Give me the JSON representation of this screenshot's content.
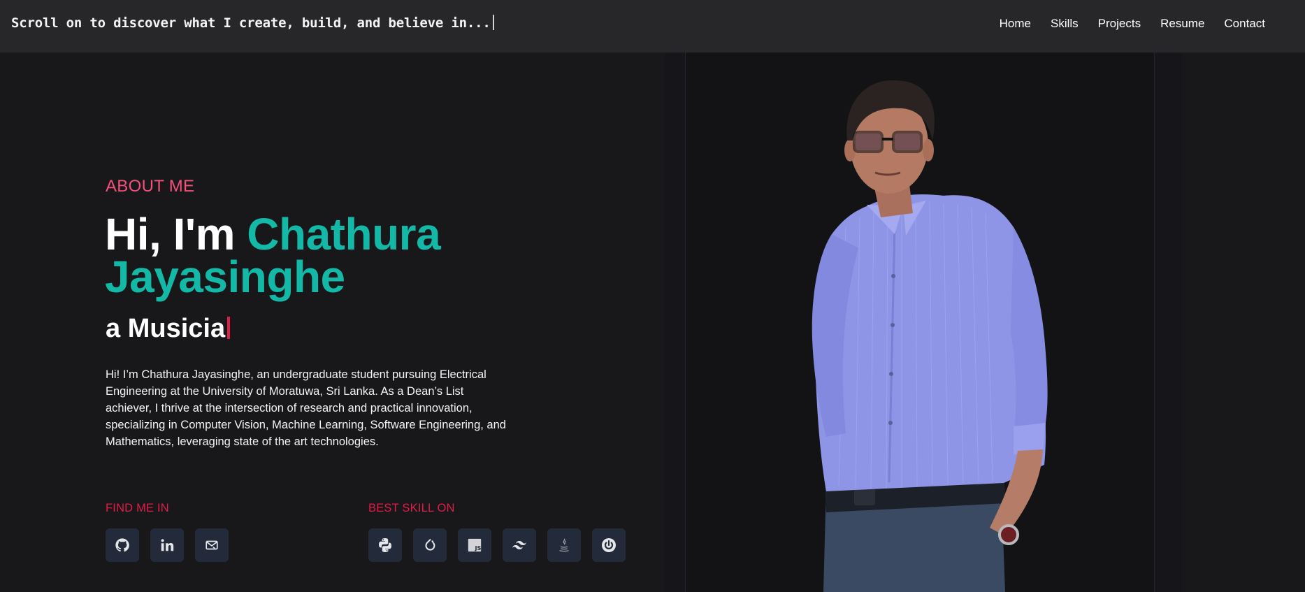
{
  "header": {
    "tagline": "Scroll on to discover what I create, build, and believe in...",
    "nav": [
      "Home",
      "Skills",
      "Projects",
      "Resume",
      "Contact"
    ]
  },
  "hero": {
    "about_label": "ABOUT ME",
    "greeting": "Hi, I'm ",
    "first_name": "Chathura",
    "last_name": "Jayasinghe",
    "role_prefix": "a ",
    "role_typed": "Musicia",
    "bio": "Hi! I’m Chathura Jayasinghe, an undergraduate student pursuing Electrical Engineering at the University of Moratuwa, Sri Lanka. As a Dean’s List achiever, I thrive at the intersection of research and practical innovation, specializing in Computer Vision, Machine Learning, Software Engineering, and Mathematics, leveraging state of the art technologies."
  },
  "find_me": {
    "label": "FIND ME IN",
    "links": [
      {
        "icon": "github-icon"
      },
      {
        "icon": "linkedin-icon"
      },
      {
        "icon": "mail-icon"
      }
    ]
  },
  "skills": {
    "label": "BEST SKILL ON",
    "items": [
      {
        "icon": "python-icon"
      },
      {
        "icon": "refresh-icon"
      },
      {
        "icon": "javascript-icon",
        "text": "JS"
      },
      {
        "icon": "tailwind-icon"
      },
      {
        "icon": "java-icon"
      },
      {
        "icon": "spring-power-icon"
      }
    ]
  },
  "colors": {
    "background": "#18181b",
    "header": "#27272a",
    "accent_teal": "#14b8a6",
    "accent_pink": "#f5507a",
    "accent_red": "#e11d48",
    "icon_tile": "#232b3b"
  }
}
